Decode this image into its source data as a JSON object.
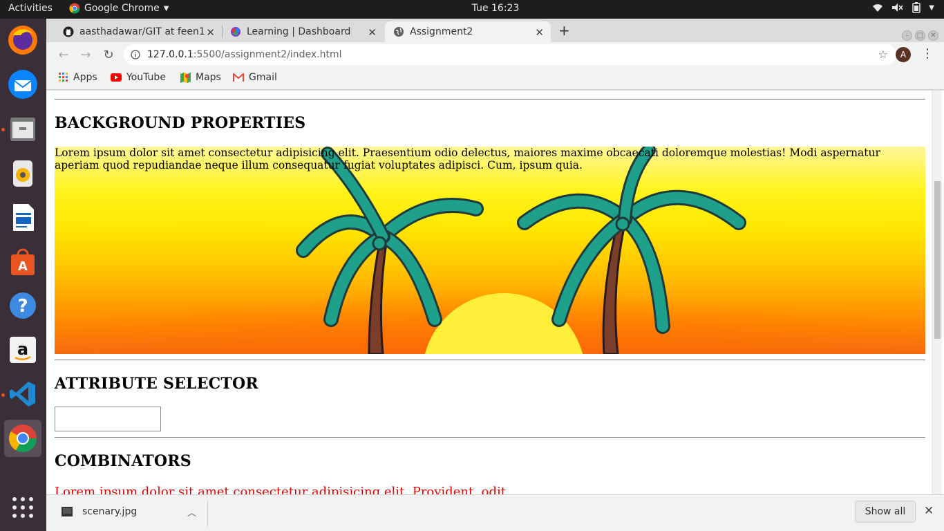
{
  "topbar": {
    "activities": "Activities",
    "app_name": "Google Chrome",
    "clock": "Tue 16:23"
  },
  "dock": {
    "items": [
      "firefox-icon",
      "thunderbird-icon",
      "files-icon",
      "rhythmbox-icon",
      "writer-icon",
      "software-icon",
      "help-icon",
      "amazon-icon",
      "vscode-icon",
      "chrome-icon",
      "show-apps-icon"
    ]
  },
  "tabs": [
    {
      "label": "aasthadawar/GIT at feen1",
      "icon": "github-icon"
    },
    {
      "label": "Learning | Dashboard",
      "icon": "learning-icon"
    },
    {
      "label": "Assignment2",
      "icon": "globe-icon",
      "active": true
    }
  ],
  "omnibox": {
    "host": "127.0.0.1",
    "path": ":5500/assignment2/index.html"
  },
  "profile_initial": "A",
  "bookmarks": [
    {
      "label": "Apps",
      "icon": "apps-grid-icon"
    },
    {
      "label": "YouTube",
      "icon": "youtube-icon"
    },
    {
      "label": "Maps",
      "icon": "maps-icon"
    },
    {
      "label": "Gmail",
      "icon": "gmail-icon"
    }
  ],
  "page": {
    "background_heading": "BACKGROUND PROPERTIES",
    "background_text": "Lorem ipsum dolor sit amet consectetur adipisicing elit. Praesentium odio delectus, maiores maxime obcaecati doloremque molestias! Modi aspernatur aperiam quod repudiandae neque illum consequatur fugiat voluptates adipisci. Cum, ipsum quia.",
    "attribute_heading": "ATTRIBUTE SELECTOR",
    "attribute_input_value": "",
    "combinators_heading": "COMBINATORS",
    "combinators_text": "Lorem ipsum dolor sit amet consectetur adipisicing elit. Provident, odit"
  },
  "downloads": {
    "filename": "scenary.jpg",
    "show_all": "Show all"
  },
  "colors": {
    "ubuntu_orange": "#e95420",
    "combinator_text": "#e00000"
  }
}
